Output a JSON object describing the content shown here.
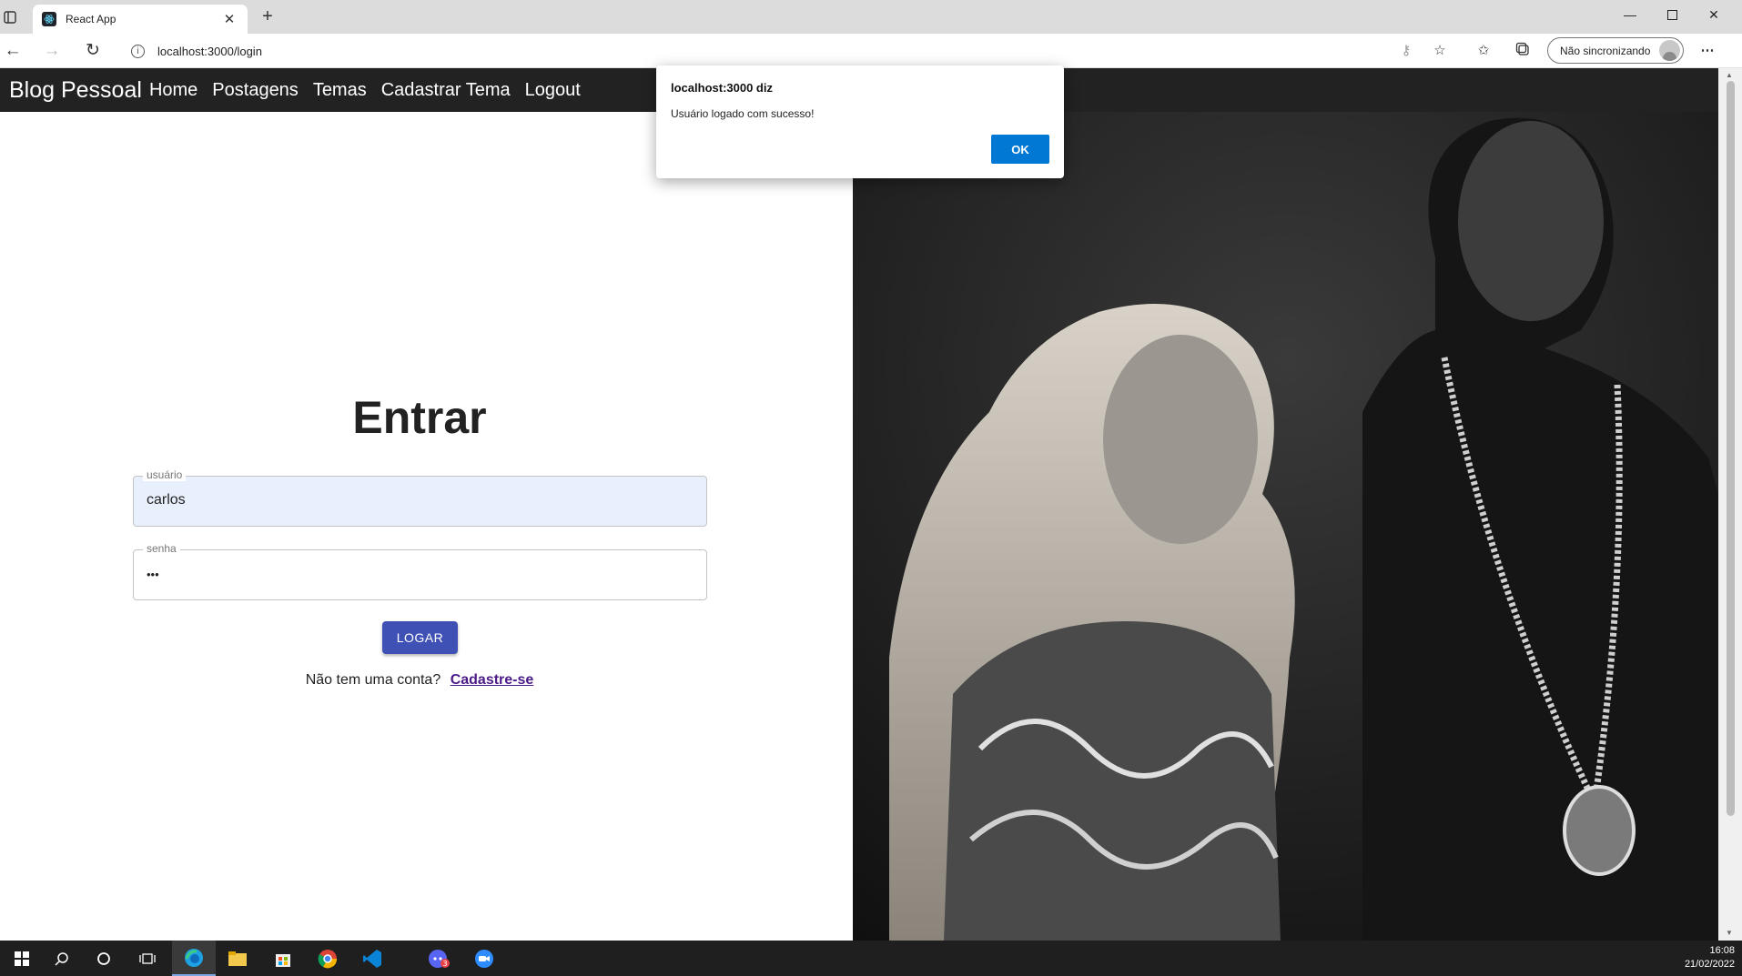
{
  "browser": {
    "tab_title": "React App",
    "url": "localhost:3000/login",
    "profile_label": "Não sincronizando"
  },
  "navbar": {
    "brand": "Blog Pessoal",
    "links": [
      "Home",
      "Postagens",
      "Temas",
      "Cadastrar Tema",
      "Logout"
    ]
  },
  "login": {
    "title": "Entrar",
    "username_label": "usuário",
    "username_value": "carlos",
    "password_label": "senha",
    "password_value": "•••",
    "submit_label": "LOGAR",
    "signup_prompt": "Não tem uma conta?",
    "signup_link": "Cadastre-se"
  },
  "alert": {
    "title": "localhost:3000 diz",
    "message": "Usuário logado com sucesso!",
    "ok_label": "OK"
  },
  "taskbar": {
    "time": "16:08",
    "date": "21/02/2022",
    "discord_badge": "3"
  },
  "colors": {
    "navbar_bg": "#222222",
    "primary_button": "#3f51b5",
    "autofill_bg": "#e8f0fe",
    "dialog_button": "#0078d4"
  }
}
